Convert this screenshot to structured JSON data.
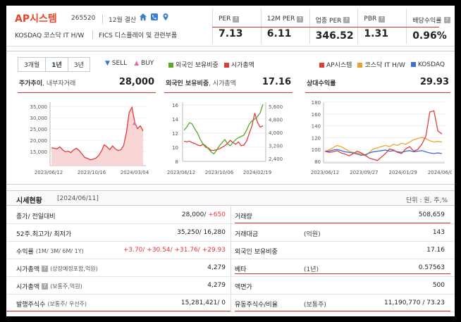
{
  "header": {
    "company_name": "AP시스템",
    "code": "265520",
    "settlement": "12월 결산",
    "market": "KOSDAQ  코스닥 IT H/W",
    "fics": "FICS 디스플레이 및 관련부품",
    "icons": [
      "home-icon",
      "phone-icon",
      "location-icon"
    ]
  },
  "metrics": [
    {
      "label": "PER",
      "value": "7.13"
    },
    {
      "label": "12M PER",
      "value": "6.11"
    },
    {
      "label": "업종 PER",
      "value": "346.52"
    },
    {
      "label": "PBR",
      "value": "1.31"
    },
    {
      "label": "배당수익률",
      "value": "0.96%"
    }
  ],
  "chart_controls": {
    "tabs": [
      "3개월",
      "1년",
      "3년"
    ],
    "active_tab": "1년",
    "sell": "SELL",
    "buy": "BUY",
    "legend_mid": [
      "외국인 보유비중",
      "시가총액"
    ],
    "legend_right": [
      "AP시스템",
      "코스닥 IT H/W",
      "KOSDAQ"
    ]
  },
  "colors": {
    "brand": "#e8462a",
    "price_line": "#e03c3c",
    "price_fill": "#f9d6d6",
    "foreign_line": "#58a82b",
    "sector_line": "#f0a030",
    "kosdaq_line": "#3a6fd8"
  },
  "panels": {
    "price": {
      "title": "주가추이",
      "sub": ", 내부자거래",
      "value": "28,000",
      "yticks": [
        "35,000",
        "30,000",
        "25,000",
        "20,000",
        "15,000"
      ],
      "xticks": [
        "2023/06/12",
        "2023/10/16",
        "2024/03/04"
      ]
    },
    "foreign": {
      "title": "외국인 보유비중",
      "sub": ", 시가총액",
      "value": "17.16",
      "yticks_left": [
        "16",
        "14",
        "12",
        "10",
        "8"
      ],
      "yticks_right": [
        "5,600",
        "4,800",
        "4,000",
        "3,200",
        "2,400"
      ],
      "xticks": [
        "2023/06/12",
        "2023/10/06",
        "2024/02/19"
      ]
    },
    "relative": {
      "title": "상대수익률",
      "sub": "",
      "value": "29.93",
      "yticks": [
        "180",
        "160",
        "140",
        "120",
        "100",
        "80"
      ],
      "xticks": [
        "2023/06/12",
        "2023/09/27",
        "2024/01/29",
        "2024/06/03"
      ]
    }
  },
  "chart_data": [
    {
      "type": "area",
      "title": "주가추이",
      "series": [
        {
          "name": "AP시스템",
          "values": [
            21200,
            21000,
            20800,
            21500,
            20500,
            19800,
            20000,
            19500,
            20500,
            21000,
            20200,
            19000,
            17800,
            17500,
            17000,
            17200,
            17600,
            18500,
            20000,
            22200,
            21500,
            20500,
            21800,
            20800,
            20200,
            20500,
            22000,
            26500,
            33500,
            35200,
            30000,
            27800,
            28800,
            27000
          ]
        }
      ],
      "ylim": [
        15000,
        37000
      ]
    },
    {
      "type": "line",
      "title": "외국인 보유비중",
      "series": [
        {
          "name": "외국인 보유비중",
          "values": [
            13.0,
            13.5,
            14.2,
            14.0,
            13.2,
            12.5,
            11.5,
            10.8,
            10.5,
            10.0,
            9.5,
            9.2,
            9.8,
            10.5,
            11.0,
            11.5,
            10.8,
            10.5,
            11.0,
            11.5,
            11.8,
            12.0,
            12.2,
            13.0,
            14.0,
            14.5,
            14.8,
            15.2,
            15.8,
            17.16
          ]
        },
        {
          "name": "시가총액",
          "values": [
            3300,
            3250,
            3300,
            3200,
            3150,
            3050,
            3000,
            3100,
            2900,
            2850,
            2700,
            2700,
            2750,
            2800,
            2900,
            3000,
            3150,
            3350,
            3200,
            3100,
            3250,
            3000,
            3050,
            3300,
            3800,
            4300,
            5100,
            4500,
            4200,
            4279
          ]
        }
      ],
      "ylim": [
        8,
        17.5
      ],
      "y2lim": [
        2000,
        5800
      ]
    },
    {
      "type": "line",
      "title": "상대수익률",
      "series": [
        {
          "name": "AP시스템",
          "values": [
            100,
            98,
            99,
            101,
            97,
            95,
            92,
            96,
            100,
            97,
            93,
            88,
            86,
            84,
            90,
            96,
            104,
            102,
            98,
            96,
            104,
            108,
            100,
            103,
            112,
            126,
            168,
            170,
            135,
            129.93
          ]
        },
        {
          "name": "코스닥 IT H/W",
          "values": [
            100,
            102,
            106,
            110,
            108,
            104,
            100,
            98,
            97,
            95,
            92,
            98,
            104,
            106,
            108,
            110,
            108,
            112,
            110,
            114,
            112,
            116,
            120,
            122,
            124,
            122,
            118,
            116,
            117,
            116
          ]
        },
        {
          "name": "KOSDAQ",
          "values": [
            100,
            100,
            102,
            103,
            101,
            99,
            98,
            97,
            95,
            93,
            94,
            97,
            99,
            100,
            101,
            102,
            100,
            101,
            99,
            98,
            100,
            101,
            99,
            100,
            101,
            99,
            97,
            96,
            97,
            96
          ]
        }
      ],
      "ylim": [
        80,
        185
      ]
    }
  ],
  "table": {
    "title": "시세현황",
    "date": "[2024/06/11]",
    "unit": "단위 : 원, 주,%",
    "rows": [
      {
        "l": "종가/ 전일대비",
        "lsub": "",
        "v1a": "28,000/ ",
        "v1b": "+650",
        "r": "거래량",
        "rsub": "",
        "v2": "508,659"
      },
      {
        "l": "52주.최고가/ 최저가",
        "lsub": "",
        "v1a": "35,250/ 16,280",
        "v1b": "",
        "r": "거래대금",
        "rsub": "(억원)",
        "v2": "143"
      },
      {
        "l": "수익률",
        "lsub": "(1M/ 3M/ 6M/ 1Y)",
        "v1a": "",
        "v1b": "+3.70/ +30.54/ +31.76/ +29.93",
        "r": "외국인 보유비중",
        "rsub": "",
        "v2": "17.16"
      },
      {
        "l": "시가총액",
        "lsub": "(상장예정포함,억원)",
        "v1a": "4,279",
        "v1b": "",
        "r": "베타",
        "rsub": "(1년)",
        "v2": "0.57563"
      },
      {
        "l": "시가총액",
        "lsub": "(보통주,억원)",
        "v1a": "4,279",
        "v1b": "",
        "r": "액면가",
        "rsub": "",
        "v2": "500"
      },
      {
        "l": "발행주식수",
        "lsub": "(보통주/ 우선주)",
        "v1a": "15,281,421/ 0",
        "v1b": "",
        "r": "유동주식수/비율",
        "rsub": "(보통주)",
        "v2": "11,190,770 / 73.23"
      }
    ]
  }
}
